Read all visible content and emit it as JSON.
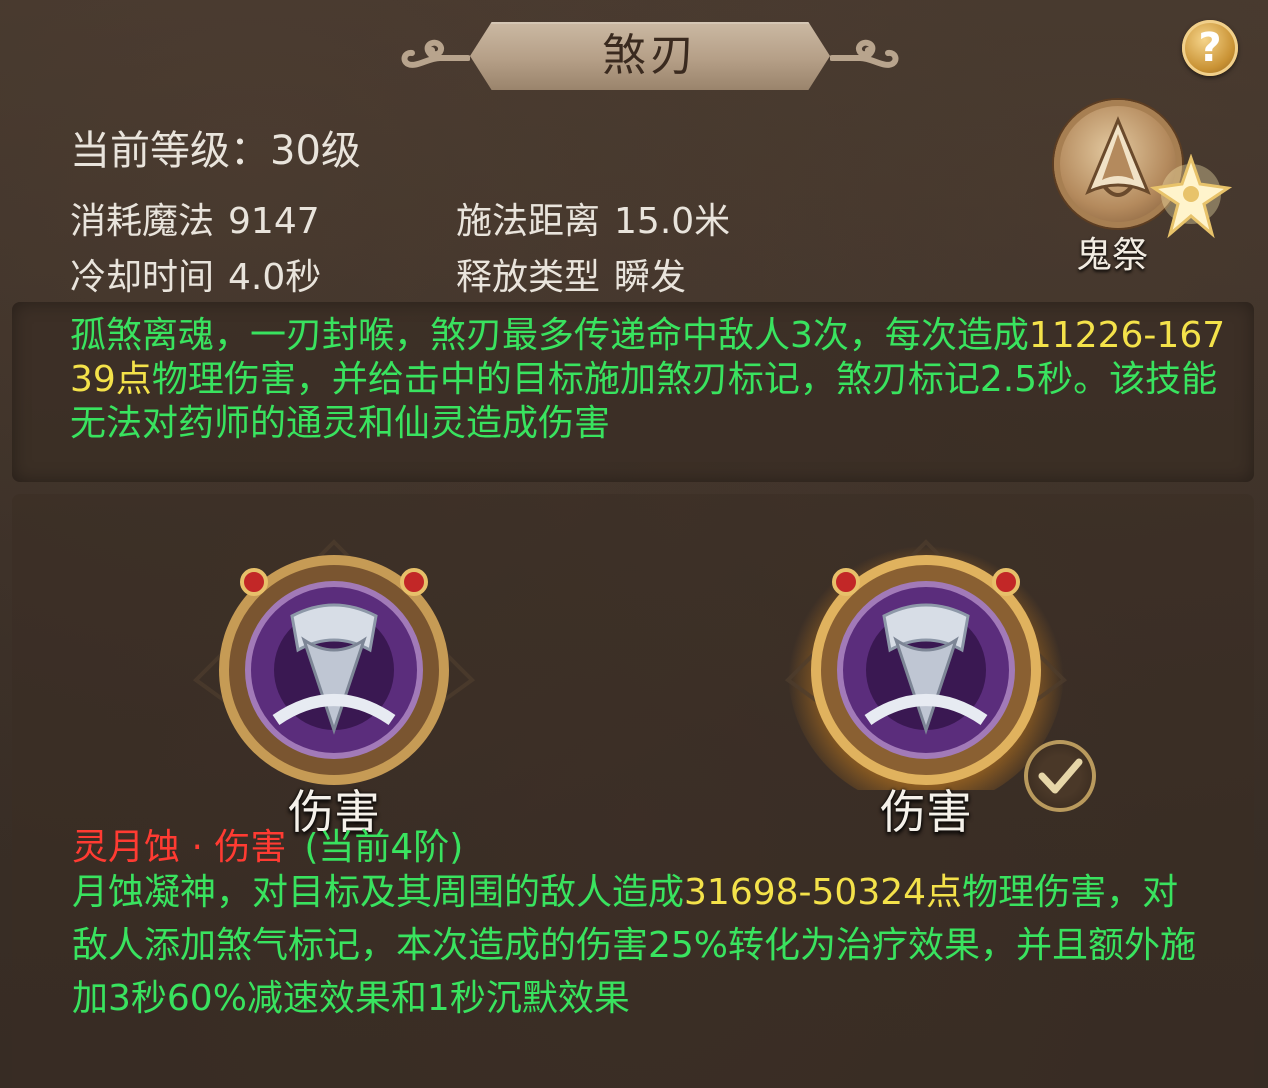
{
  "header": {
    "title": "煞刃",
    "help_label": "?"
  },
  "skill": {
    "level_label": "当前等级：",
    "level_value": "30级",
    "stats": {
      "mana_label": "消耗魔法",
      "mana_value": "9147",
      "range_label": "施法距离",
      "range_value": "15.0米",
      "cooldown_label": "冷却时间",
      "cooldown_value": "4.0秒",
      "cast_label": "释放类型",
      "cast_value": "瞬发"
    },
    "emblem_label": "鬼祭",
    "description_pre": "孤煞离魂，一刃封喉，煞刃最多传递命中敌人3次，每次造成",
    "description_dmg": "11226-16739点",
    "description_post": "物理伤害，并给击中的目标施加煞刃标记，煞刃标记2.5秒。该技能无法对药师的通灵和仙灵造成伤害"
  },
  "options": [
    {
      "label": "伤害",
      "selected": false
    },
    {
      "label": "伤害",
      "selected": true
    }
  ],
  "upgrade": {
    "name": "灵月蚀 · 伤害",
    "tier": "(当前4阶)",
    "desc_pre": "月蚀凝神，对目标及其周围的敌人造成",
    "desc_dmg": "31698-50324点",
    "desc_post": "物理伤害，对敌人添加煞气标记，本次造成的伤害25%转化为治疗效果，并且额外施加3秒60%减速效果和1秒沉默效果"
  },
  "colors": {
    "green_text": "#39e35f",
    "yellow_text": "#f4e24a",
    "red_text": "#ff3b32"
  }
}
